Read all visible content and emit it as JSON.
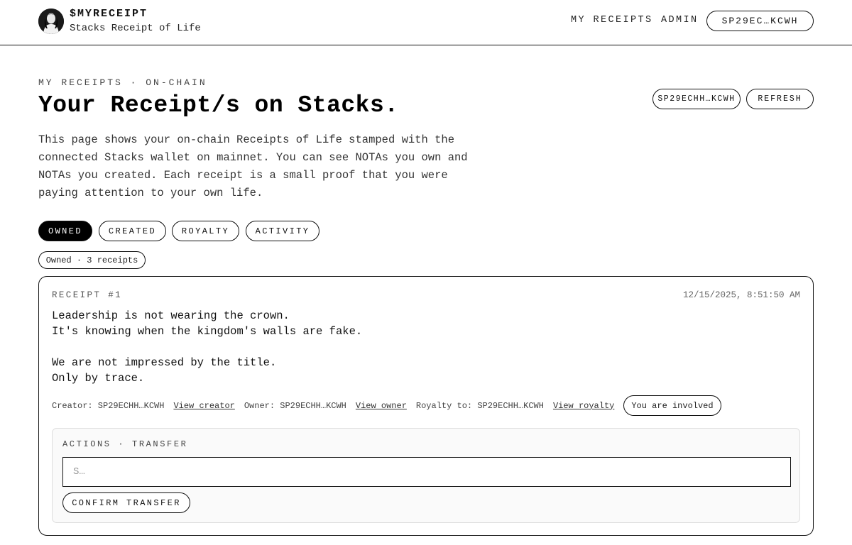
{
  "header": {
    "brand_name": "$MYRECEIPT",
    "brand_sub": "Stacks Receipt of Life",
    "nav": [
      {
        "label": "MY RECEIPTS"
      },
      {
        "label": "ADMIN"
      }
    ],
    "wallet_label": "SP29EC…KCWH"
  },
  "page": {
    "kicker": "MY RECEIPTS · ON-CHAIN",
    "title": "Your Receipt/s on Stacks.",
    "description": "This page shows your on-chain Receipts of Life stamped with the connected Stacks wallet on mainnet. You can see NOTAs you own and NOTAs you created. Each receipt is a small proof that you were paying attention to your own life.",
    "address_pill": "SP29ECHH…KCWH",
    "refresh_label": "REFRESH"
  },
  "tabs": [
    {
      "label": "OWNED",
      "active": true
    },
    {
      "label": "CREATED",
      "active": false
    },
    {
      "label": "ROYALTY",
      "active": false
    },
    {
      "label": "ACTIVITY",
      "active": false
    }
  ],
  "count_badge": "Owned · 3 receipts",
  "receipt": {
    "label": "RECEIPT #1",
    "date": "12/15/2025, 8:51:50 AM",
    "lines": [
      "Leadership is not wearing the crown.",
      "It's knowing when the kingdom's walls are fake.",
      "",
      "We are not impressed by the title.",
      "Only by trace."
    ],
    "meta": {
      "creator_text": "Creator: SP29ECHH…KCWH",
      "creator_link": "View creator",
      "owner_text": "Owner: SP29ECHH…KCWH",
      "owner_link": "View owner",
      "royalty_text": "Royalty to: SP29ECHH…KCWH",
      "royalty_link": "View royalty",
      "involved_badge": "You are involved"
    },
    "actions": {
      "label": "ACTIONS · TRANSFER",
      "input_placeholder": "S…",
      "input_value": "",
      "confirm_label": "CONFIRM TRANSFER"
    }
  },
  "colors": {
    "accent": "#000000",
    "background": "#ffffff",
    "panel": "#fafafa"
  }
}
